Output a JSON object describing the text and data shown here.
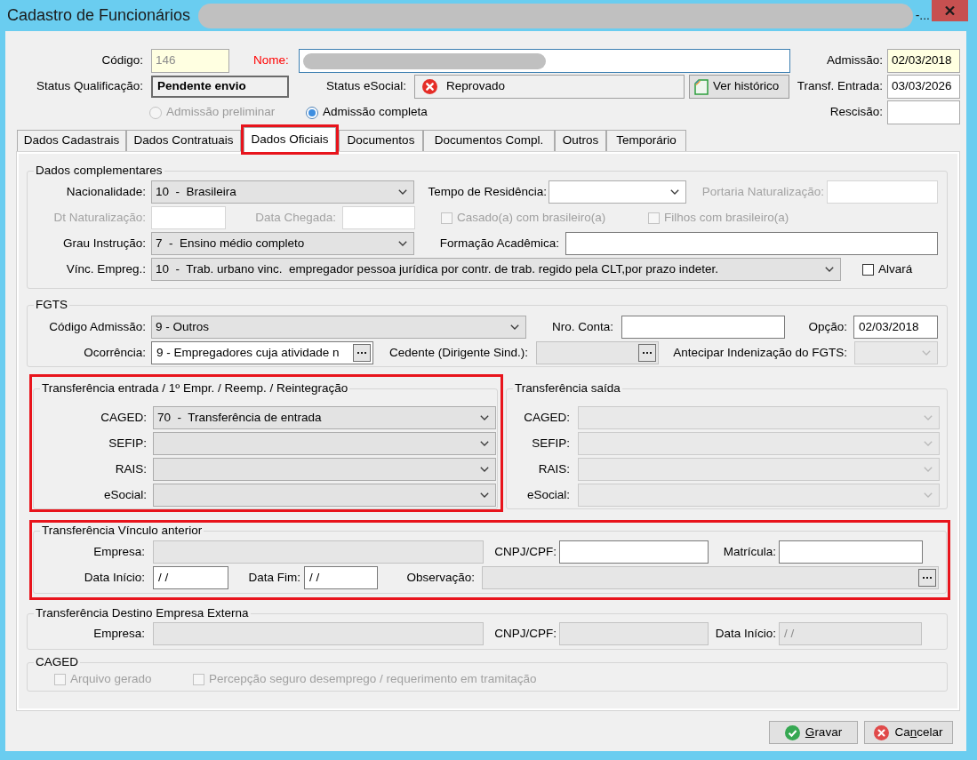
{
  "window": {
    "title": "Cadastro de Funcionários",
    "title_tail": "-..."
  },
  "header": {
    "codigo": {
      "label": "Código:",
      "value": "146",
      "tinted": true,
      "readonly": true
    },
    "nome": {
      "label": "Nome:",
      "required": true,
      "focused": true
    },
    "admissao": {
      "label": "Admissão:",
      "value": "02/03/2018",
      "tinted": true,
      "readonly": false
    },
    "status_qualificacao": {
      "label": "Status Qualificação:",
      "value": "Pendente envio"
    },
    "status_esocial": {
      "label": "Status eSocial:",
      "value": "Reprovado",
      "error": true
    },
    "history_button": {
      "label": "Ver histórico"
    },
    "transf_entrada": {
      "label": "Transf. Entrada:",
      "value": "03/03/2026",
      "tinted": false,
      "readonly": false
    },
    "admission_type": [
      {
        "label": "Admissão preliminar",
        "selected": false,
        "disabled": true
      },
      {
        "label": "Admissão completa",
        "selected": true,
        "disabled": false
      }
    ],
    "rescisao": {
      "label": "Rescisão:",
      "tinted": false
    }
  },
  "tabs": [
    {
      "label": "Dados Cadastrais",
      "selected": false,
      "annotated": false
    },
    {
      "label": "Dados Contratuais",
      "selected": false,
      "annotated": false
    },
    {
      "label": "Dados Oficiais",
      "selected": true,
      "annotated": true
    },
    {
      "label": "Documentos",
      "selected": false,
      "annotated": false
    },
    {
      "label": "Documentos Compl.",
      "selected": false,
      "annotated": false
    },
    {
      "label": "Outros",
      "selected": false,
      "annotated": false
    },
    {
      "label": "Temporário",
      "selected": false,
      "annotated": false
    }
  ],
  "dados_complementares": {
    "title": "Dados complementares",
    "fields": [
      {
        "label": "Nacionalidade:",
        "kind": "select",
        "value": "10  -  Brasileira",
        "disabled": false,
        "label_dimmed": false
      },
      {
        "label": "Tempo de Residência:",
        "kind": "combo",
        "disabled": false,
        "label_dimmed": false
      },
      {
        "label": "Portaria Naturalização:",
        "kind": "text",
        "disabled": true,
        "readonly": false,
        "label_dimmed": true
      },
      {
        "label": "Dt Naturalização:",
        "kind": "text",
        "disabled": true,
        "readonly": false,
        "label_dimmed": true
      },
      {
        "label": "Data Chegada:",
        "kind": "text",
        "disabled": true,
        "readonly": false,
        "label_dimmed": true
      },
      {
        "label": "Casado(a) com brasileiro(a)",
        "kind": "checkbox",
        "checked": false,
        "disabled": true
      },
      {
        "label": "Filhos com brasileiro(a)",
        "kind": "checkbox",
        "checked": false,
        "disabled": true
      },
      {
        "label": "Grau Instrução:",
        "kind": "select",
        "value": "7  -  Ensino médio completo",
        "disabled": false,
        "label_dimmed": false
      },
      {
        "label": "Formação Acadêmica:",
        "kind": "text",
        "disabled": false,
        "readonly": false,
        "label_dimmed": false
      },
      {
        "label": "Vínc. Empreg.:",
        "kind": "select",
        "value": "10  -  Trab. urbano vinc.  empregador pessoa jurídica por contr. de trab. regido pela CLT,por prazo indeter.",
        "disabled": false,
        "label_dimmed": false
      },
      {
        "label": "Alvará",
        "kind": "checkbox",
        "checked": false,
        "disabled": false
      }
    ]
  },
  "fgts": {
    "title": "FGTS",
    "fields": [
      {
        "label": "Código Admissão:",
        "kind": "select",
        "value": "9 - Outros",
        "disabled": false,
        "label_dimmed": false
      },
      {
        "label": "Nro. Conta:",
        "kind": "text",
        "disabled": false,
        "readonly": false,
        "label_dimmed": false
      },
      {
        "label": "Opção:",
        "kind": "text",
        "value": "02/03/2018",
        "disabled": false,
        "readonly": false,
        "label_dimmed": false
      },
      {
        "label": "Ocorrência:",
        "kind": "lookup",
        "value": "9 - Empregadores cuja atividade n",
        "disabled": false,
        "readonly": false,
        "label_dimmed": false
      },
      {
        "label": "Cedente (Dirigente Sind.):",
        "kind": "lookup",
        "disabled": false,
        "readonly": true,
        "label_dimmed": false
      },
      {
        "label": "Antecipar Indenização do FGTS:",
        "kind": "select",
        "disabled": true,
        "label_dimmed": false
      }
    ]
  },
  "transferencia_entrada": {
    "title": "Transferência entrada / 1º Empr. / Reemp. / Reintegração",
    "annotated": true,
    "fields": [
      {
        "label": "CAGED:",
        "kind": "select",
        "value": "70  -  Transferência de entrada",
        "disabled": false,
        "label_dimmed": false
      },
      {
        "label": "SEFIP:",
        "kind": "select",
        "disabled": false,
        "label_dimmed": false
      },
      {
        "label": "RAIS:",
        "kind": "select",
        "disabled": false,
        "label_dimmed": false
      },
      {
        "label": "eSocial:",
        "kind": "select",
        "disabled": false,
        "label_dimmed": false
      }
    ]
  },
  "transferencia_saida": {
    "title": "Transferência saída",
    "fields": [
      {
        "label": "CAGED:",
        "kind": "select",
        "disabled": true,
        "label_dimmed": false
      },
      {
        "label": "SEFIP:",
        "kind": "select",
        "disabled": true,
        "label_dimmed": false
      },
      {
        "label": "RAIS:",
        "kind": "select",
        "disabled": true,
        "label_dimmed": false
      },
      {
        "label": "eSocial:",
        "kind": "select",
        "disabled": true,
        "label_dimmed": false
      }
    ]
  },
  "vinculo_anterior": {
    "title": "Transferência Vínculo anterior",
    "annotated": true,
    "fields": [
      {
        "label": "Empresa:",
        "kind": "text",
        "disabled": false,
        "readonly": true,
        "label_dimmed": false
      },
      {
        "label": "CNPJ/CPF:",
        "kind": "text",
        "disabled": false,
        "readonly": false,
        "label_dimmed": false
      },
      {
        "label": "Matrícula:",
        "kind": "text",
        "disabled": false,
        "readonly": false,
        "label_dimmed": false
      },
      {
        "label": "Data Início:",
        "kind": "text",
        "value": "/ /",
        "disabled": false,
        "readonly": false,
        "label_dimmed": false
      },
      {
        "label": "Data Fim:",
        "kind": "text",
        "value": "/ /",
        "disabled": false,
        "readonly": false,
        "label_dimmed": false
      },
      {
        "label": "Observação:",
        "kind": "lookup",
        "disabled": false,
        "readonly": true,
        "label_dimmed": false
      }
    ]
  },
  "destino_empresa_externa": {
    "title": "Transferência Destino Empresa Externa",
    "fields": [
      {
        "label": "Empresa:",
        "kind": "text",
        "disabled": false,
        "readonly": true,
        "label_dimmed": false
      },
      {
        "label": "CNPJ/CPF:",
        "kind": "text",
        "disabled": false,
        "readonly": true,
        "label_dimmed": false
      },
      {
        "label": "Data Início:",
        "kind": "text",
        "value": "/ /",
        "disabled": false,
        "readonly": true,
        "label_dimmed": false
      }
    ]
  },
  "caged": {
    "title": "CAGED",
    "fields": [
      {
        "label": "Arquivo gerado",
        "kind": "checkbox",
        "checked": false,
        "disabled": true
      },
      {
        "label": "Percepção seguro desemprego / requerimento em tramitação",
        "kind": "checkbox",
        "checked": false,
        "disabled": true
      }
    ]
  },
  "buttons": [
    {
      "kind": "save",
      "label_parts": [
        {
          "text": "G",
          "underline": true
        },
        {
          "text": "ravar",
          "underline": false
        }
      ]
    },
    {
      "kind": "cancel",
      "label_parts": [
        {
          "text": "Ca",
          "underline": false
        },
        {
          "text": "n",
          "underline": true
        },
        {
          "text": "celar",
          "underline": false
        }
      ]
    }
  ]
}
